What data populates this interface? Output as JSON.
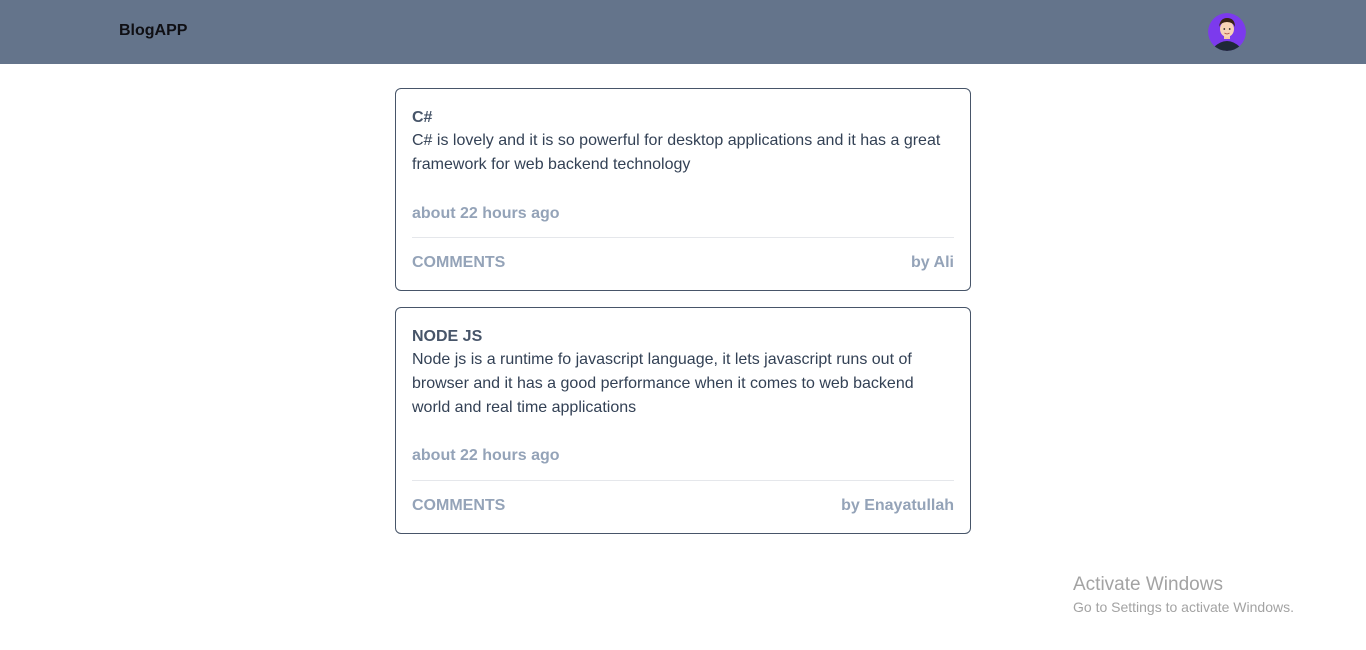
{
  "navbar": {
    "brand": "BlogAPP",
    "avatar_icon": "user-avatar-icon",
    "avatar_color": "#7c3aed"
  },
  "posts": [
    {
      "title": "C#",
      "body": "C# is lovely and it is so powerful for desktop applications and it has a great framework for web backend technology",
      "time": "about 22 hours ago",
      "comments_label": "COMMENTS",
      "author": "by Ali"
    },
    {
      "title": "NODE JS",
      "body": "Node js is a runtime fo javascript language, it lets javascript runs out of browser and it has a good performance when it comes to web backend world and real time applications",
      "time": "about 22 hours ago",
      "comments_label": "COMMENTS",
      "author": "by Enayatullah"
    }
  ],
  "watermark": {
    "title": "Activate Windows",
    "subtitle": "Go to Settings to activate Windows."
  },
  "colors": {
    "navbar_bg": "#64748b",
    "card_border": "#475569",
    "muted_text": "#94a3b8"
  }
}
